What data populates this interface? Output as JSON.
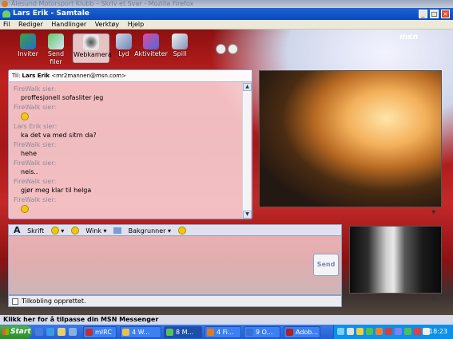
{
  "browser_title": "Ålesund Motorsport Klubb  – Skriv et Svar - Mozilla Firefox",
  "window": {
    "title": "Lars Erik - Samtale"
  },
  "menu": [
    "Fil",
    "Rediger",
    "Handlinger",
    "Verktøy",
    "Hjelp"
  ],
  "toolbar": {
    "buttons": [
      {
        "label": "Inviter",
        "icon": "invite-icon"
      },
      {
        "label": "Send filer",
        "icon": "send-files-icon"
      },
      {
        "label": "Webkamera",
        "icon": "webcam-icon",
        "selected": true
      },
      {
        "label": "Lyd",
        "icon": "audio-icon"
      },
      {
        "label": "Aktiviteter",
        "icon": "activities-icon"
      },
      {
        "label": "Spill",
        "icon": "games-icon"
      }
    ],
    "brand": "msn"
  },
  "chat": {
    "to_label": "Til:",
    "to_name": "Lars Erik",
    "to_email": "<mr2mannen@msn.com>",
    "messages": [
      {
        "sender": "FireWalk sier:",
        "text": "proffesjonell sofasliter jeg"
      },
      {
        "sender": "FireWalk sier:",
        "text": "",
        "emoticon": "smiley-icon"
      },
      {
        "sender": "Lars Erik sier:",
        "text": "ka det va med sitrn da?"
      },
      {
        "sender": "FireWalk sier:",
        "text": "hehe"
      },
      {
        "sender": "FireWalk sier:",
        "text": "neis.."
      },
      {
        "sender": "FireWalk sier:",
        "text": "gjør meg klar til helga"
      },
      {
        "sender": "FireWalk sier:",
        "text": "",
        "emoticon": "smiley-icon"
      }
    ]
  },
  "input_toolbar": {
    "font_label": "Skrift",
    "wink_label": "Wink",
    "backgrounds_label": "Bakgrunner"
  },
  "send_label": "Send",
  "status_text": "Tilkobling opprettet.",
  "tip_text": "Klikk her for å tilpasse din MSN Messenger",
  "taskbar": {
    "start_label": "Start",
    "tasks": [
      {
        "label": "mIRC"
      },
      {
        "label": "4 W..."
      },
      {
        "label": "8 M...",
        "active": true
      },
      {
        "label": "4 Fi..."
      },
      {
        "label": "9 O..."
      },
      {
        "label": "Adob..."
      }
    ],
    "clock": "18:23"
  },
  "colors": {
    "title_blue": "#0a49b8",
    "chat_bg": "#ffe1e4",
    "taskbar_blue": "#245ed0",
    "start_green": "#2d8a2d"
  }
}
